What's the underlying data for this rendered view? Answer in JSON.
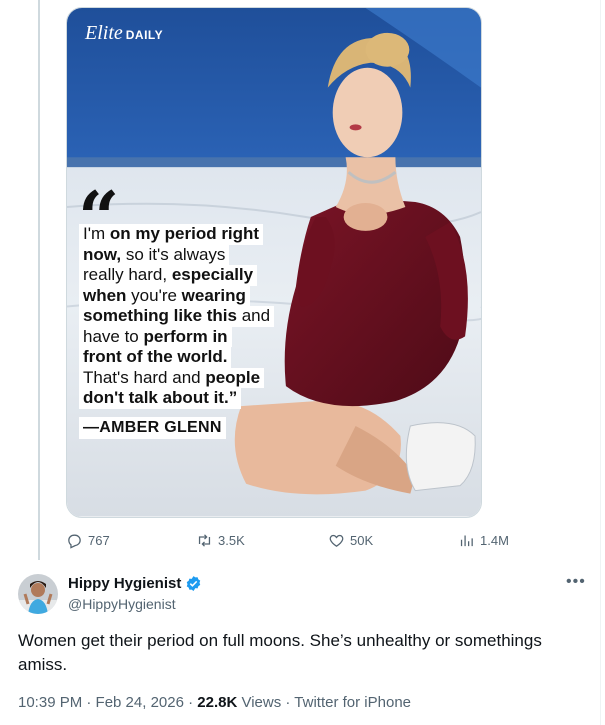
{
  "media": {
    "brand_script": "Elite",
    "brand_word": "DAILY",
    "quote_mark": "“",
    "quote_lines": [
      [
        {
          "t": "I'm ",
          "b": false
        },
        {
          "t": "on my period right",
          "b": true
        }
      ],
      [
        {
          "t": "now,",
          "b": true
        },
        {
          "t": " so it's always",
          "b": false
        }
      ],
      [
        {
          "t": "really hard, ",
          "b": false
        },
        {
          "t": "especially",
          "b": true
        }
      ],
      [
        {
          "t": "when",
          "b": true
        },
        {
          "t": " you're ",
          "b": false
        },
        {
          "t": "wearing",
          "b": true
        }
      ],
      [
        {
          "t": "something like this",
          "b": true
        },
        {
          "t": " and",
          "b": false
        }
      ],
      [
        {
          "t": "have to ",
          "b": false
        },
        {
          "t": "perform in",
          "b": true
        }
      ],
      [
        {
          "t": "front of the world.",
          "b": true
        }
      ],
      [
        {
          "t": "That's hard and ",
          "b": false
        },
        {
          "t": "people",
          "b": true
        }
      ],
      [
        {
          "t": "don't talk about it.”",
          "b": true
        }
      ]
    ],
    "attribution": "—AMBER GLENN"
  },
  "actions": {
    "replies": "767",
    "reposts": "3.5K",
    "likes": "50K",
    "views": "1.4M"
  },
  "reply": {
    "display_name": "Hippy Hygienist",
    "handle": "@HippyHygienist",
    "text": "Women get their period on full moons. She’s unhealthy or somethings amiss.",
    "time": "10:39 PM · Feb 24, 2026 · ",
    "views_count": "22.8K",
    "views_label": " Views",
    "source": " · Twitter for iPhone"
  },
  "colors": {
    "verified": "#1d9bf0",
    "muted_text": "#536471",
    "dress": "#6b1020"
  },
  "icons": [
    "reply-icon",
    "repost-icon",
    "like-icon",
    "views-icon",
    "verified-badge-icon",
    "more-icon"
  ]
}
